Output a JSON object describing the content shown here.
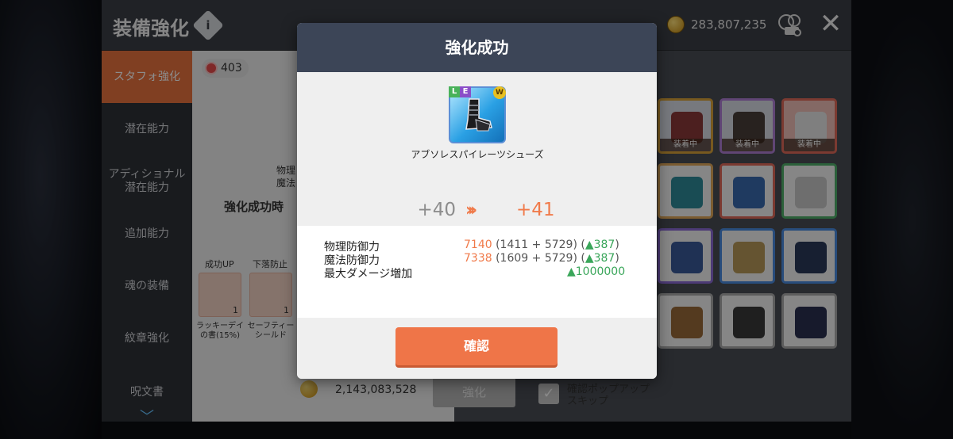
{
  "header": {
    "title": "装備強化",
    "currency_amount": "283,807,235"
  },
  "sidebar": {
    "items": [
      {
        "label": "スタフォ強化",
        "active": true
      },
      {
        "label": "潜在能力"
      },
      {
        "label": "アディショナル潜在能力"
      },
      {
        "label": "追加能力"
      },
      {
        "label": "魂の装備"
      },
      {
        "label": "紋章強化"
      },
      {
        "label": "呪文書"
      }
    ]
  },
  "enhance_panel": {
    "star_count": "403",
    "success_time_label": "強化成功時",
    "slots": [
      {
        "label": "成功UP",
        "name": "ラッキーデイの書(15%)",
        "count": "1"
      },
      {
        "label": "下落防止",
        "name": "セーフティーシールド",
        "count": "1"
      }
    ],
    "prop_physical": "物理",
    "prop_magic": "魔法",
    "cost_amount": "2,143,083,528",
    "enhance_button": "強化",
    "skip_label": "確認ポップアップスキップ"
  },
  "inventory": {
    "equipped_label": "装着中"
  },
  "modal": {
    "title": "強化成功",
    "item_name": "アブソレスパイレーツシューズ",
    "grade_badges": [
      "L",
      "E"
    ],
    "level_from": "+40",
    "level_to": "+41",
    "stats": [
      {
        "name": "物理防御力",
        "value": "7140",
        "detail": "(1411 + 5729)",
        "increase": "▲387"
      },
      {
        "name": "魔法防御力",
        "value": "7338",
        "detail": "(1609 + 5729)",
        "increase": "▲387"
      },
      {
        "name": "最大ダメージ増加",
        "increase": "▲1000000"
      }
    ],
    "confirm_button": "確認"
  },
  "colors": {
    "accent_orange": "#ef7548",
    "modal_header": "#3c4557",
    "increase_green": "#3aa65a"
  }
}
